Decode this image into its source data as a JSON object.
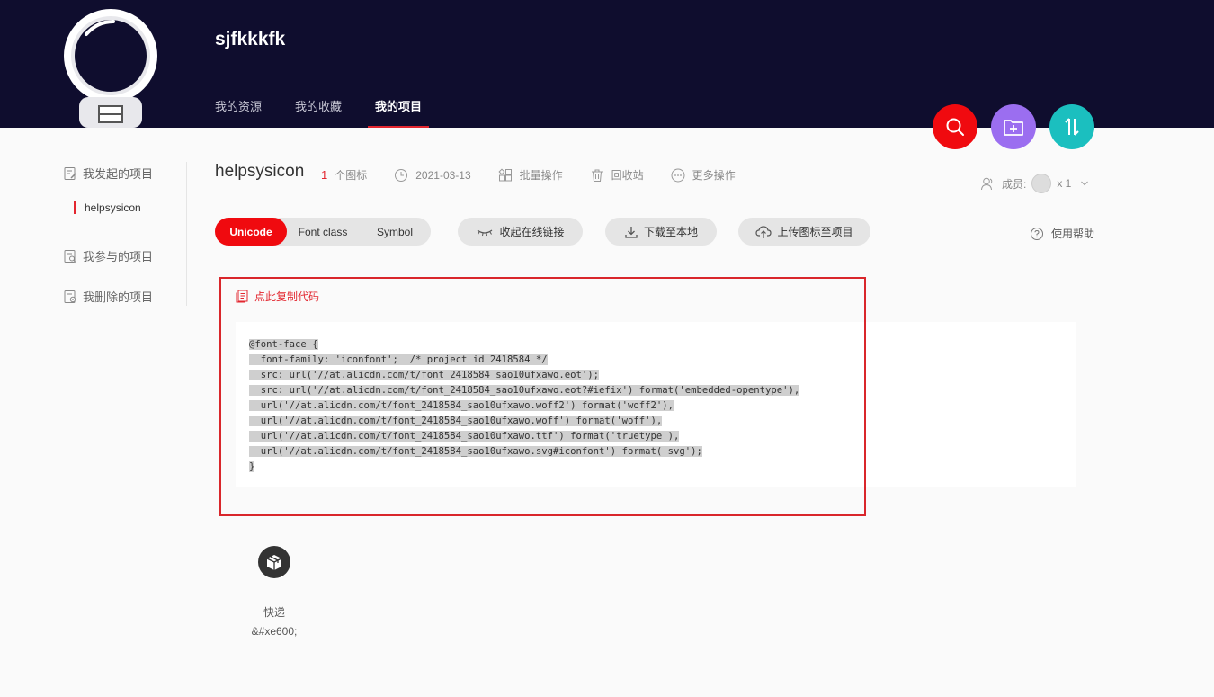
{
  "header": {
    "username": "sjfkkkfk",
    "nav": [
      "我的资源",
      "我的收藏",
      "我的项目"
    ],
    "active_nav_index": 2,
    "colors": {
      "background": "#0f0d2e",
      "accent": "#e3262f"
    }
  },
  "fab": {
    "search_icon": "search-icon",
    "add_folder_icon": "folder-add-icon",
    "sort_icon": "sort-arrows-icon",
    "colors": [
      "#f00a0f",
      "#9b6ef0",
      "#1bbfbf"
    ]
  },
  "sidebar": {
    "items": [
      {
        "label": "我发起的项目",
        "icon": "edit-doc-icon"
      },
      {
        "label": "我参与的项目",
        "icon": "search-doc-icon"
      },
      {
        "label": "我删除的项目",
        "icon": "settings-doc-icon"
      }
    ],
    "active_project": "helpsysicon"
  },
  "project": {
    "name": "helpsysicon",
    "icon_count": "1",
    "icon_count_label": "个图标",
    "date": "2021-03-13",
    "actions": [
      "批量操作",
      "回收站",
      "更多操作"
    ],
    "members_label": "成员:",
    "members_count": "x 1"
  },
  "tabs": {
    "options": [
      "Unicode",
      "Font class",
      "Symbol"
    ],
    "active_index": 0
  },
  "buttons": {
    "collapse_link": "收起在线链接",
    "download": "下载至本地",
    "upload": "上传图标至项目",
    "help": "使用帮助"
  },
  "code_panel": {
    "copy_label": "点此复制代码",
    "lines": [
      "@font-face {",
      "  font-family: 'iconfont';  /* project id 2418584 */",
      "  src: url('//at.alicdn.com/t/font_2418584_sao10ufxawo.eot');",
      "  src: url('//at.alicdn.com/t/font_2418584_sao10ufxawo.eot?#iefix') format('embedded-opentype'),",
      "  url('//at.alicdn.com/t/font_2418584_sao10ufxawo.woff2') format('woff2'),",
      "  url('//at.alicdn.com/t/font_2418584_sao10ufxawo.woff') format('woff'),",
      "  url('//at.alicdn.com/t/font_2418584_sao10ufxawo.ttf') format('truetype'),",
      "  url('//at.alicdn.com/t/font_2418584_sao10ufxawo.svg#iconfont') format('svg');",
      "}"
    ]
  },
  "icons": [
    {
      "name": "快递",
      "code": "&#xe600;",
      "icon": "package-icon"
    }
  ]
}
